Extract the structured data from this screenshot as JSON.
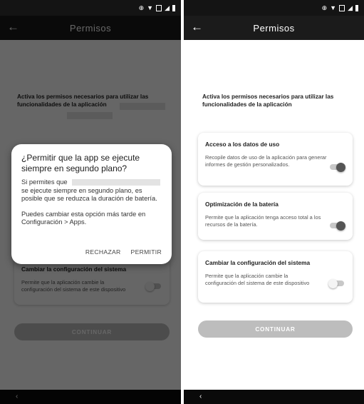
{
  "status_bar": {
    "icons": [
      "sync-icon",
      "wifi-icon",
      "lte-icon",
      "signal-icon",
      "battery-icon"
    ]
  },
  "app_bar": {
    "title": "Permisos",
    "back_icon": "←"
  },
  "intro_text": "Activa los permisos necesarios para utilizar las funcionalidades de la aplicación",
  "permissions": [
    {
      "title": "Acceso a los datos de uso",
      "description": "Recopile datos de uso de la aplicación para generar informes de gestión personalizados.",
      "enabled": true
    },
    {
      "title": "Optimización de la batería",
      "description": "Permite que la aplicación tenga acceso total a los recursos de la batería.",
      "enabled": true
    },
    {
      "title": "Cambiar la configuración del sistema",
      "description": "Permite que la aplicación cambie la configuración del sistema de este dispositivo",
      "enabled": false
    }
  ],
  "continue_button": "CONTINUAR",
  "dialog": {
    "title": "¿Permitir que la app se ejecute siempre en segundo plano?",
    "line1": "Si permites que",
    "line2": "se ejecute siempre en segundo plano, es posible que se reduzca la duración de batería.",
    "paragraph2": "Puedes cambiar esta opción más tarde en Configuración > Apps.",
    "deny": "RECHAZAR",
    "allow": "PERMITIR"
  },
  "nav_bar": {
    "back": "‹"
  },
  "colors": {
    "toolbar": "#1b1b1b",
    "status_bar": "#141414",
    "toggle_on_knob": "#555555",
    "toggle_off_knob": "#f4f4f4",
    "button_disabled": "#bdbdbd"
  }
}
